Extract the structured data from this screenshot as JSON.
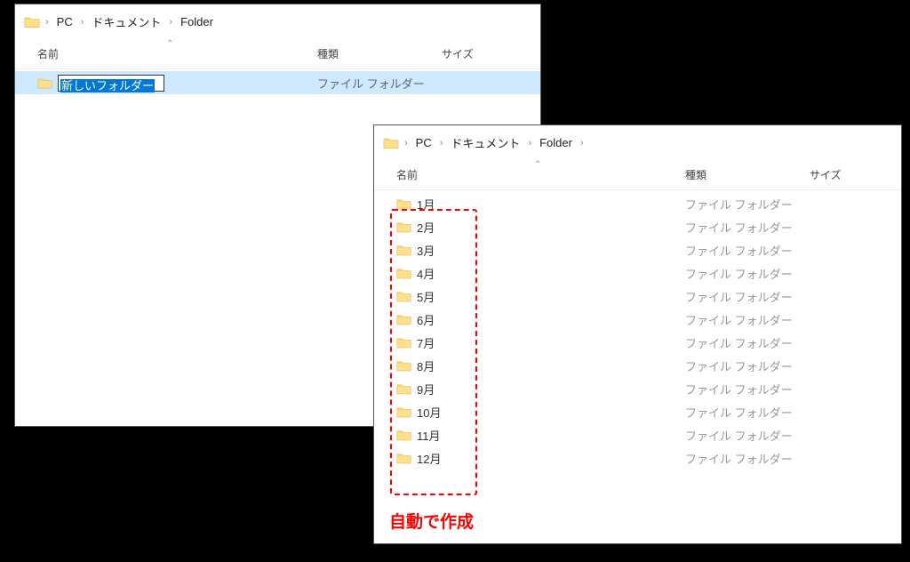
{
  "window1": {
    "breadcrumb": [
      "PC",
      "ドキュメント",
      "Folder"
    ],
    "trailing_sep": false,
    "columns": {
      "name": "名前",
      "type": "種類",
      "size": "サイズ"
    },
    "sort_glyph": "⌃",
    "new_folder": {
      "rename_text": "新しいフォルダー",
      "type": "ファイル フォルダー"
    }
  },
  "window2": {
    "breadcrumb": [
      "PC",
      "ドキュメント",
      "Folder"
    ],
    "trailing_sep": true,
    "columns": {
      "name": "名前",
      "type": "種類",
      "size": "サイズ"
    },
    "sort_glyph": "⌃",
    "folder_type": "ファイル フォルダー",
    "folders": [
      "1月",
      "2月",
      "3月",
      "4月",
      "5月",
      "6月",
      "7月",
      "8月",
      "9月",
      "10月",
      "11月",
      "12月"
    ],
    "caption": "自動で作成"
  },
  "icons": {
    "folder_svg": "folder"
  }
}
